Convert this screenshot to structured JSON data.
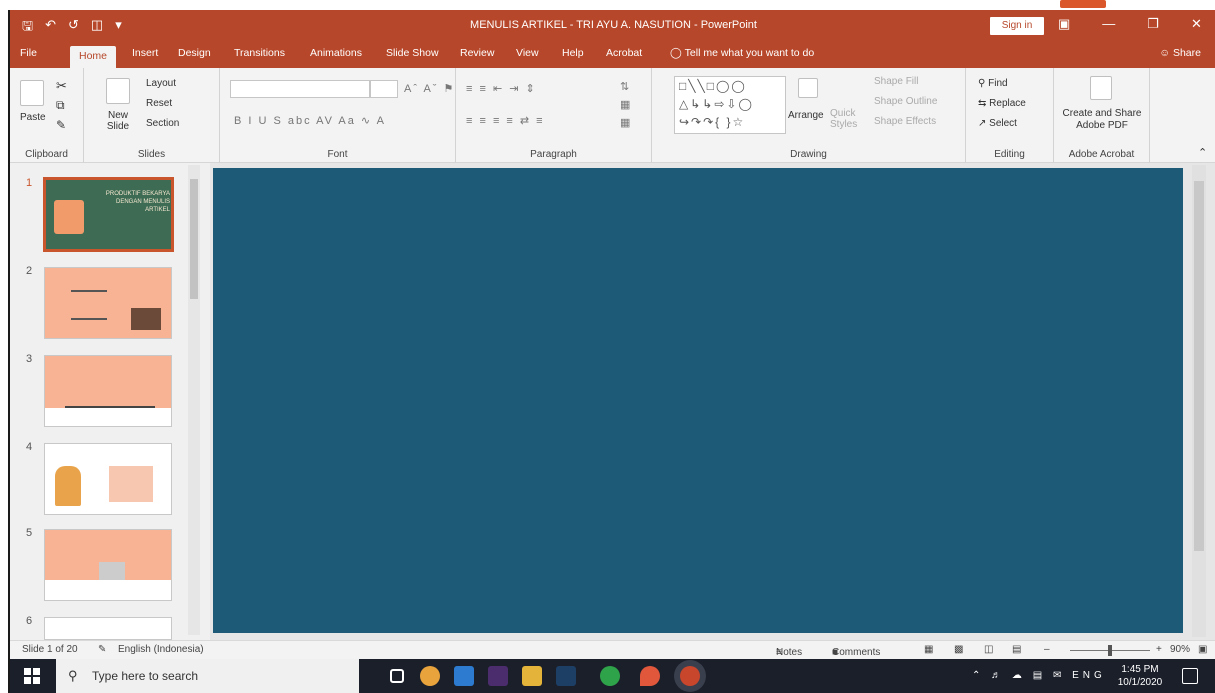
{
  "window": {
    "title": "MENULIS ARTIKEL - TRI AYU A. NASUTION - PowerPoint",
    "sign_in": "Sign in"
  },
  "tabs": [
    "File",
    "Home",
    "Insert",
    "Design",
    "Transitions",
    "Animations",
    "Slide Show",
    "Review",
    "View",
    "Help",
    "Acrobat"
  ],
  "active_tab": "Home",
  "tell_me": "Tell me what you want to do",
  "share": "Share",
  "ribbon": {
    "clipboard": {
      "paste": "Paste",
      "group": "Clipboard"
    },
    "slides": {
      "new_slide": "New Slide",
      "layout": "Layout",
      "reset": "Reset",
      "section": "Section",
      "group": "Slides"
    },
    "font": {
      "group": "Font",
      "font_name": "",
      "font_size": ""
    },
    "paragraph": {
      "group": "Paragraph"
    },
    "drawing": {
      "arrange": "Arrange",
      "quick_styles": "Quick Styles",
      "shape_fill": "Shape Fill",
      "shape_outline": "Shape Outline",
      "shape_effects": "Shape Effects",
      "group": "Drawing"
    },
    "editing": {
      "find": "Find",
      "replace": "Replace",
      "select": "Select",
      "group": "Editing"
    },
    "acrobat": {
      "create": "Create and Share Adobe PDF",
      "group": "Adobe Acrobat"
    }
  },
  "slides": [
    {
      "num": "1",
      "title": "PRODUKTIF BEKARYA DENGAN MENULIS ARTIKEL",
      "bg": "#3d6b54",
      "selected": true
    },
    {
      "num": "2",
      "title": "",
      "bg": "#f7b393",
      "selected": false
    },
    {
      "num": "3",
      "title": "",
      "bg": "#f7b393",
      "selected": false
    },
    {
      "num": "4",
      "title": "",
      "bg": "#ffffff",
      "selected": false
    },
    {
      "num": "5",
      "title": "",
      "bg": "#f7b393",
      "selected": false
    },
    {
      "num": "6",
      "title": "",
      "bg": "#ffffff",
      "selected": false
    }
  ],
  "canvas_color": "#1d5a78",
  "status": {
    "slide_info": "Slide 1 of 20",
    "language": "English (Indonesia)",
    "notes": "Notes",
    "comments": "Comments",
    "zoom": "90%"
  },
  "taskbar": {
    "search_placeholder": "Type here to search",
    "lang": "ENG",
    "time": "1:45 PM",
    "date": "10/1/2020",
    "apps": [
      {
        "name": "task-view",
        "color": "#1b1f2a"
      },
      {
        "name": "chrome",
        "color": "#e8a33d"
      },
      {
        "name": "mail",
        "color": "#2d7bd1"
      },
      {
        "name": "premiere",
        "color": "#4b2d6e"
      },
      {
        "name": "file-explorer",
        "color": "#e4b33a"
      },
      {
        "name": "photoshop",
        "color": "#1d3f66"
      },
      {
        "name": "green-app",
        "color": "#2fa34a"
      },
      {
        "name": "drop-app",
        "color": "#e0573b"
      },
      {
        "name": "powerpoint",
        "color": "#c8462c"
      }
    ]
  }
}
